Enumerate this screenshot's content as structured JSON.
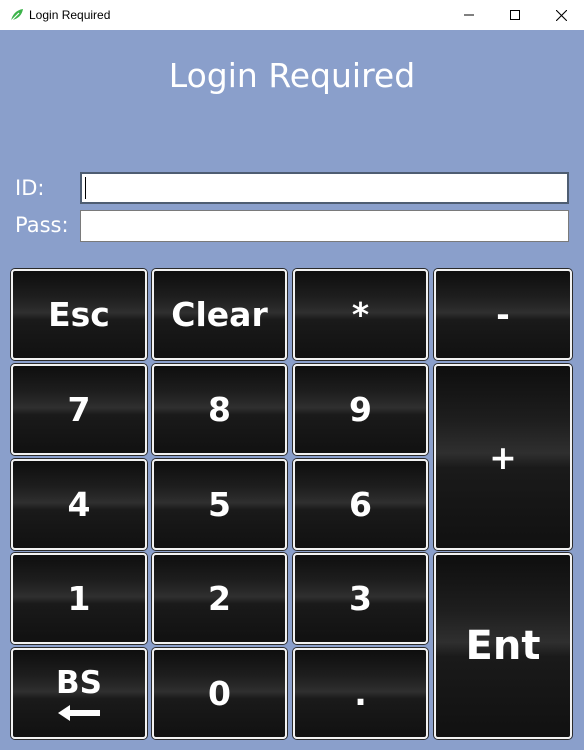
{
  "window": {
    "title": "Login Required",
    "buttons": [
      "minimize-icon",
      "maximize-icon",
      "close-icon"
    ]
  },
  "heading": "Login Required",
  "form": {
    "id_label": "ID:",
    "id_value": "",
    "pass_label": "Pass:",
    "pass_value": ""
  },
  "keypad": {
    "esc": "Esc",
    "clear": "Clear",
    "star": "*",
    "minus": "-",
    "seven": "7",
    "eight": "8",
    "nine": "9",
    "plus": "+",
    "four": "4",
    "five": "5",
    "six": "6",
    "one": "1",
    "two": "2",
    "three": "3",
    "enter": "Ent",
    "backspace": "BS",
    "backspace_icon": "left-arrow-icon",
    "zero": "0",
    "dot": "."
  },
  "colors": {
    "background": "#8a9fcb",
    "key_face": "#1a1a1a",
    "key_border": "#f2f2f2",
    "app_icon": "#3cb34a"
  }
}
